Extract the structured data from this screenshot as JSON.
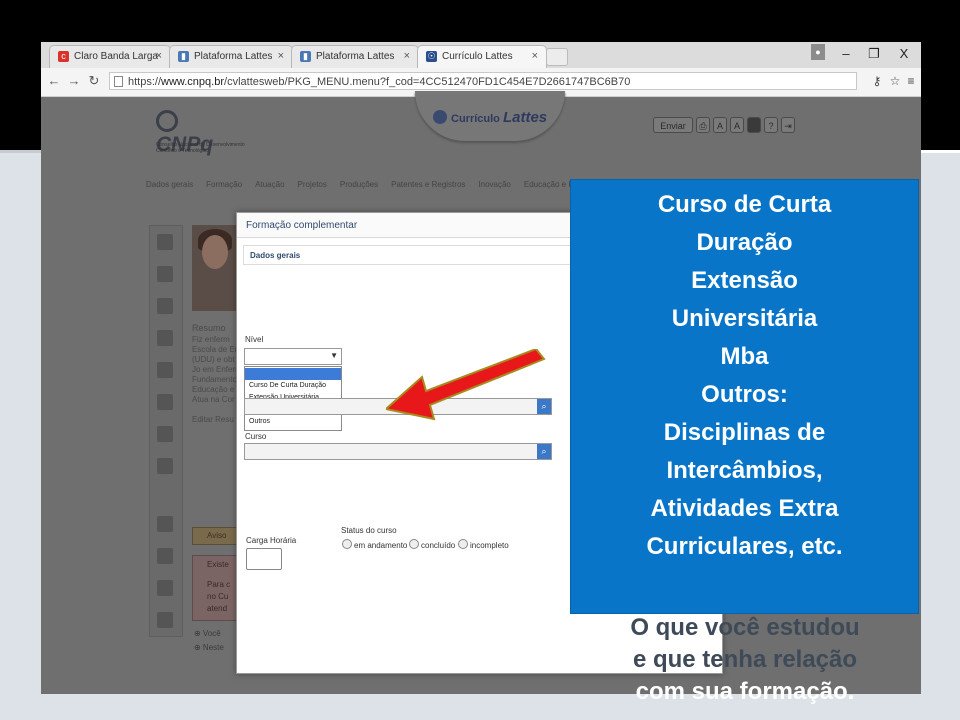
{
  "browser": {
    "tabs": [
      {
        "title": "Claro Banda Larga",
        "fav_color": "#d9342b",
        "active": false
      },
      {
        "title": "Plataforma Lattes",
        "fav_color": "#4a78b4",
        "active": false
      },
      {
        "title": "Plataforma Lattes",
        "fav_color": "#4a78b4",
        "active": false
      },
      {
        "title": "Currículo Lattes",
        "fav_color": "#2b4e8c",
        "active": true
      }
    ],
    "close_glyph": "×",
    "url_scheme": "https://",
    "url_host": "www.cnpq.br",
    "url_path": "/cvlattesweb/PKG_MENU.menu?f_cod=4CC512470FD1C454E7D2661747BC6B70",
    "win_controls": {
      "minimize": "–",
      "maximize": "❐",
      "close": "X"
    }
  },
  "site": {
    "logo_text": "CNPq",
    "logo_subtitle": "Conselho Nacional de Desenvolvimento Científico e Tecnológico",
    "lattes_label": "Currículo",
    "lattes_brand": "Lattes",
    "share_label": "Enviar",
    "help_label": "?",
    "nav": [
      "Dados gerais",
      "Formação",
      "Atuação",
      "Projetos",
      "Produções",
      "Patentes e Registros",
      "Inovação",
      "Educação e Popu"
    ],
    "resumo_title": "Resumo",
    "resumo_lines": [
      "Fiz enferm",
      "Escola de En",
      "(UDU) e obt",
      "Jo em Enferm",
      "Fundamento",
      "Educação e",
      "Atua na Cor"
    ],
    "edit_label": "Editar Resu",
    "alert_title": "Aviso",
    "alert_lines": [
      "Existe",
      "Para c",
      "no Cu",
      "atend"
    ],
    "footer_lines": [
      "Você",
      "Neste"
    ]
  },
  "modal": {
    "title": "Formação complementar",
    "section": "Dados gerais",
    "nivel_label": "Nível",
    "dropdown_options": [
      "",
      "Curso De Curta Duração",
      "Extensão Universitária",
      "Mba",
      "Outros"
    ],
    "curso_label": "Curso",
    "carga_label": "Carga Horária",
    "status_label": "Status do curso",
    "status_options": [
      "em andamento",
      "concluído",
      "incompleto"
    ]
  },
  "callout": {
    "lines": [
      "Curso de Curta",
      "Duração",
      "Extensão",
      "Universitária",
      "Mba",
      "Outros:",
      "Disciplinas de",
      "Intercâmbios,",
      "Atividades Extra",
      "Curriculares, etc."
    ],
    "bg_color": "#0875c9"
  },
  "bottom_text": {
    "line1": "O que você estudou",
    "line2": "e que tenha relação",
    "line3": "com sua formação."
  }
}
